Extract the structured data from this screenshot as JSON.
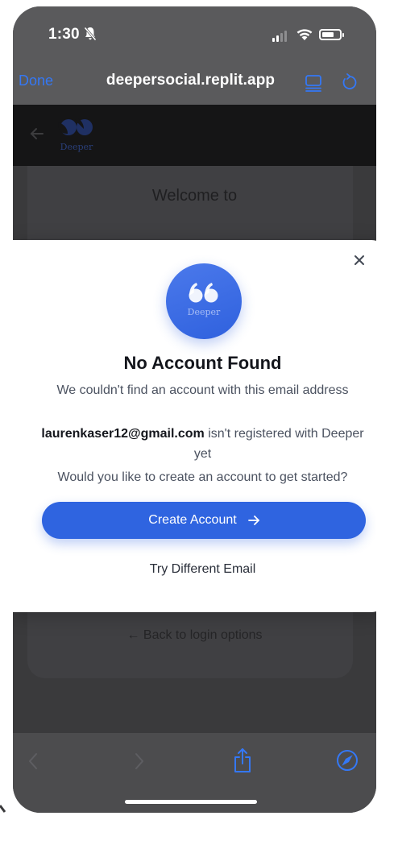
{
  "status_bar": {
    "time": "1:30",
    "icons": [
      "bell-slash-icon",
      "cellular-signal-icon",
      "wifi-icon",
      "battery-icon"
    ]
  },
  "browser": {
    "done_label": "Done",
    "url": "deepersocial.replit.app",
    "icons": [
      "reader-mode-icon",
      "reload-icon",
      "back-icon",
      "forward-icon",
      "share-icon",
      "compass-icon"
    ],
    "accent_color": "#3478f6"
  },
  "site": {
    "logo_text": "Deeper",
    "welcome_text": "Welcome to",
    "back_login_text": "← Back to login options"
  },
  "modal": {
    "logo_text": "Deeper",
    "title": "No Account Found",
    "subtitle": "We couldn't find an account with this email address",
    "email": "laurenkaser12@gmail.com",
    "email_suffix": " isn't registered with Deeper yet",
    "question": "Would you like to create an account to get started?",
    "create_button": "Create Account",
    "try_other_button": "Try Different Email",
    "primary_color": "#2f64e0"
  }
}
